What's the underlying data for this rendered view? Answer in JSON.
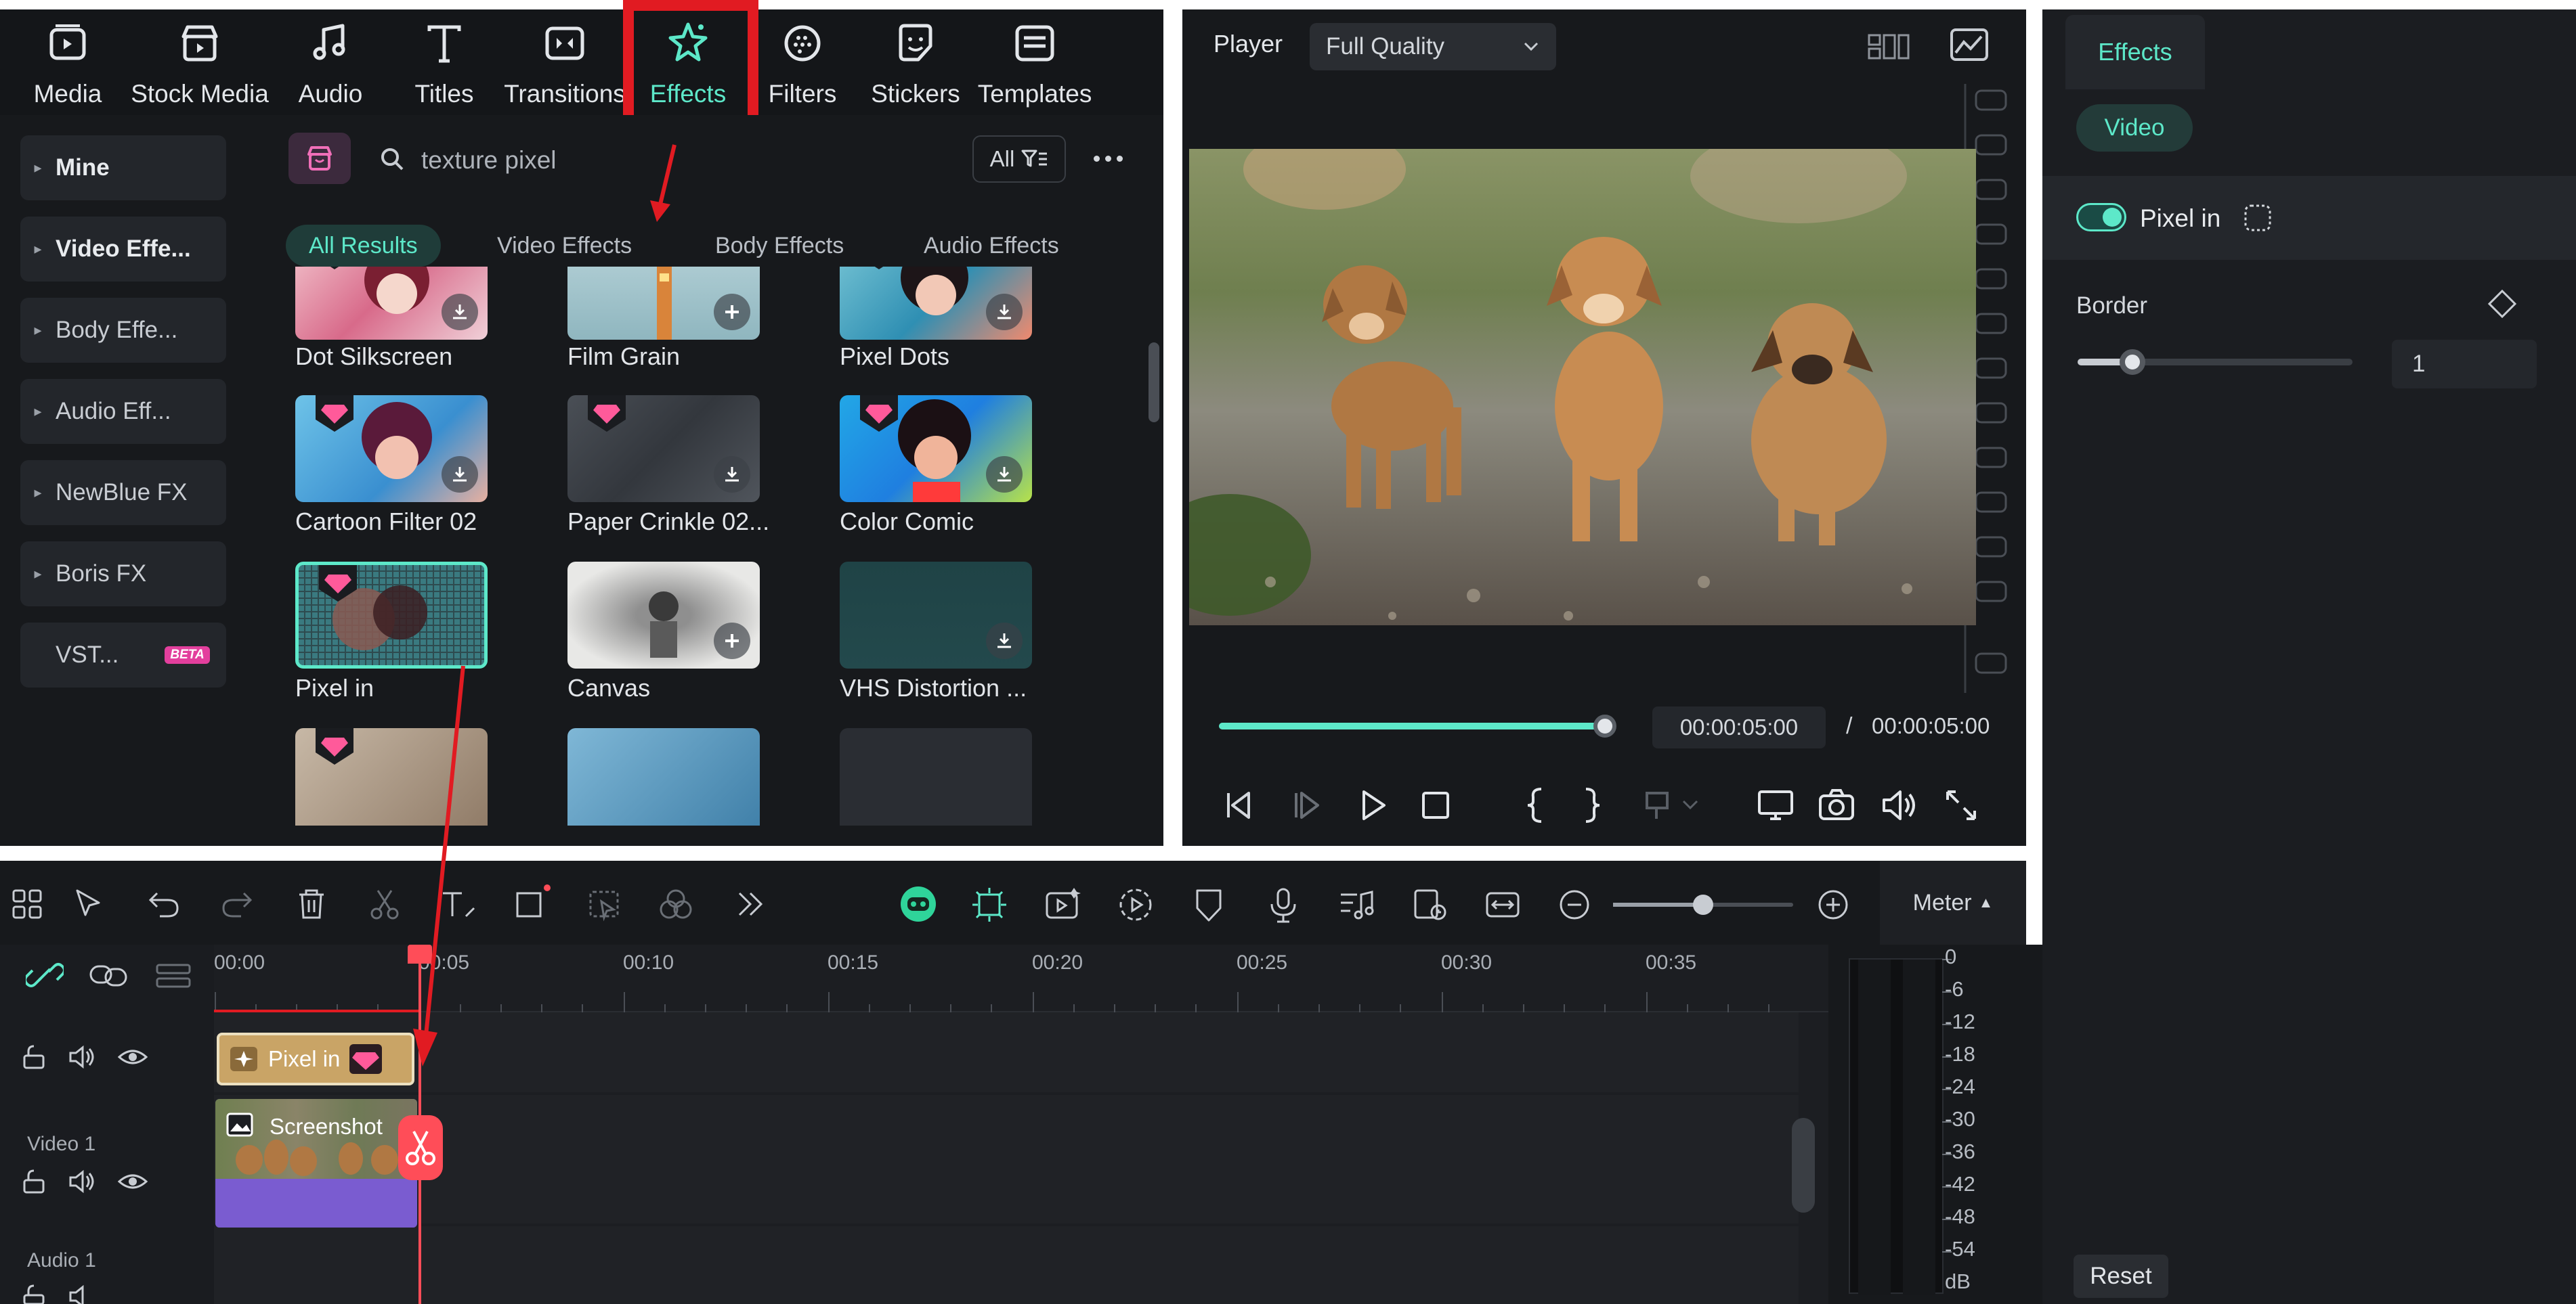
{
  "toolbar": {
    "items": [
      {
        "label": "Media",
        "icon": "media-icon"
      },
      {
        "label": "Stock Media",
        "icon": "stock-media-icon"
      },
      {
        "label": "Audio",
        "icon": "audio-note-icon"
      },
      {
        "label": "Titles",
        "icon": "titles-t-icon"
      },
      {
        "label": "Transitions",
        "icon": "transitions-icon"
      },
      {
        "label": "Effects",
        "icon": "effects-star-icon",
        "active": true
      },
      {
        "label": "Filters",
        "icon": "filters-icon"
      },
      {
        "label": "Stickers",
        "icon": "stickers-icon"
      },
      {
        "label": "Templates",
        "icon": "templates-icon"
      }
    ]
  },
  "left_categories": [
    {
      "label": "Mine"
    },
    {
      "label": "Video Effe..."
    },
    {
      "label": "Body Effe..."
    },
    {
      "label": "Audio Eff..."
    },
    {
      "label": "NewBlue FX"
    },
    {
      "label": "Boris FX"
    },
    {
      "label": "VST...",
      "badge": "BETA"
    }
  ],
  "search": {
    "value": "texture pixel",
    "filter_label": "All"
  },
  "result_tabs": [
    {
      "label": "All Results",
      "active": true
    },
    {
      "label": "Video Effects"
    },
    {
      "label": "Body Effects"
    },
    {
      "label": "Audio Effects"
    }
  ],
  "effect_cards": [
    {
      "label": "Dot Silkscreen",
      "premium": true,
      "action": "download"
    },
    {
      "label": "Film Grain",
      "premium": false,
      "action": "add"
    },
    {
      "label": "Pixel Dots",
      "premium": true,
      "action": "download"
    },
    {
      "label": "Cartoon Filter 02",
      "premium": true,
      "action": "download"
    },
    {
      "label": "Paper Crinkle 02...",
      "premium": true,
      "action": "download"
    },
    {
      "label": "Color Comic",
      "premium": true,
      "action": "download"
    },
    {
      "label": "Pixel in",
      "premium": true,
      "action": "none",
      "selected": true
    },
    {
      "label": "Canvas",
      "premium": false,
      "action": "add"
    },
    {
      "label": "VHS Distortion ...",
      "premium": false,
      "action": "download"
    }
  ],
  "player": {
    "label": "Player",
    "quality": "Full Quality",
    "progress_fraction": 1.0,
    "current_time": "00:00:05:00",
    "separator": "/",
    "total_time": "00:00:05:00"
  },
  "props": {
    "tab": "Effects",
    "subtab": "Video",
    "effect_name": "Pixel in",
    "effect_enabled": true,
    "param_label": "Border",
    "param_value": "1",
    "slider_fraction": 0.2,
    "reset_label": "Reset"
  },
  "timeline": {
    "meter_label": "Meter",
    "zoom_fraction": 0.5,
    "ruler": [
      "00:00",
      "00:05",
      "00:10",
      "00:15",
      "00:20",
      "00:25",
      "00:30",
      "00:35"
    ],
    "tracks": [
      {
        "label": "Video 1"
      },
      {
        "label": "Audio 1"
      }
    ],
    "effect_clip": "Pixel in",
    "video_clip": "Screenshot"
  },
  "meter": {
    "scale": [
      "0",
      "-6",
      "-12",
      "-18",
      "-24",
      "-30",
      "-36",
      "-42",
      "-48",
      "-54",
      "dB"
    ]
  },
  "colors": {
    "accent": "#5de8c9",
    "highlight_red": "#e11b22",
    "playhead": "#ff4d58",
    "effect_clip": "#c9a466",
    "premium_gem": "#ff5a9a",
    "audio_purple": "#7a5cd0"
  }
}
